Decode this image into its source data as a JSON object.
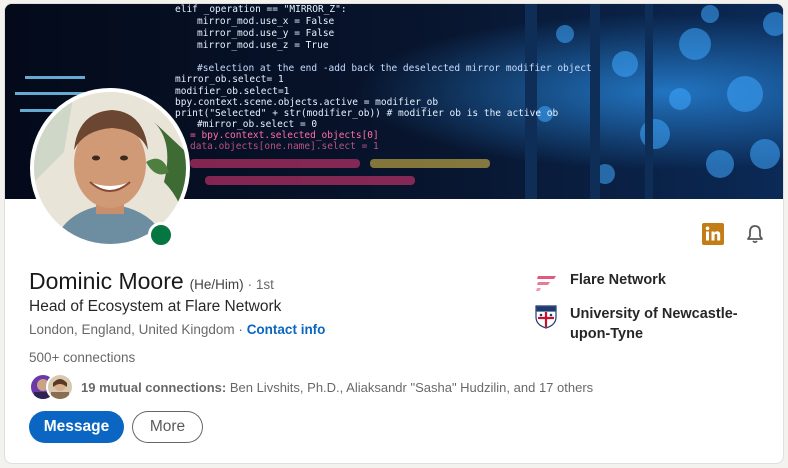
{
  "profile": {
    "name": "Dominic Moore",
    "pronouns": "(He/Him)",
    "degree": "· 1st",
    "headline": "Head of Ecosystem at Flare Network",
    "location": "London, England, United Kingdom",
    "location_separator": "·",
    "contact_label": "Contact info",
    "connections": "500+ connections"
  },
  "mutual": {
    "count_label": "19 mutual connections:",
    "names": "Ben Livshits, Ph.D., Aliaksandr \"Sasha\" Hudzilin, and 17 others"
  },
  "actions": {
    "message_label": "Message",
    "more_label": "More"
  },
  "organizations": [
    {
      "name": "Flare Network",
      "logo": "flare-logo"
    },
    {
      "name": "University of Newcastle-upon-Tyne",
      "logo": "newcastle-university-crest"
    }
  ],
  "icons": {
    "linkedin": "linkedin-icon",
    "notifications": "bell-icon",
    "online_status": "online-status-dot"
  },
  "banner_code": [
    "elif _operation == \"MIRROR_Z\":",
    "mirror_mod.use_x = False",
    "mirror_mod.use_y = False",
    "mirror_mod.use_z = True",
    "#selection at the end -add back the deselected mirror modifier object",
    "mirror_ob.select= 1",
    "modifier_ob.select=1",
    "bpy.context.scene.objects.active = modifier_ob",
    "print(\"Selected\" + str(modifier_ob)) # modifier ob is the active ob",
    "#mirror_ob.select = 0",
    "= bpy.context.selected_objects[0]",
    "data.objects[one.name].select = 1"
  ],
  "colors": {
    "primary": "#0a66c2",
    "online": "#057642",
    "linkedin_badge": "#c37d16",
    "banner_bg": "#050c1e",
    "flare_pink": "#e3587e",
    "university_blue": "#1e3a6e",
    "university_red": "#c8102e"
  }
}
